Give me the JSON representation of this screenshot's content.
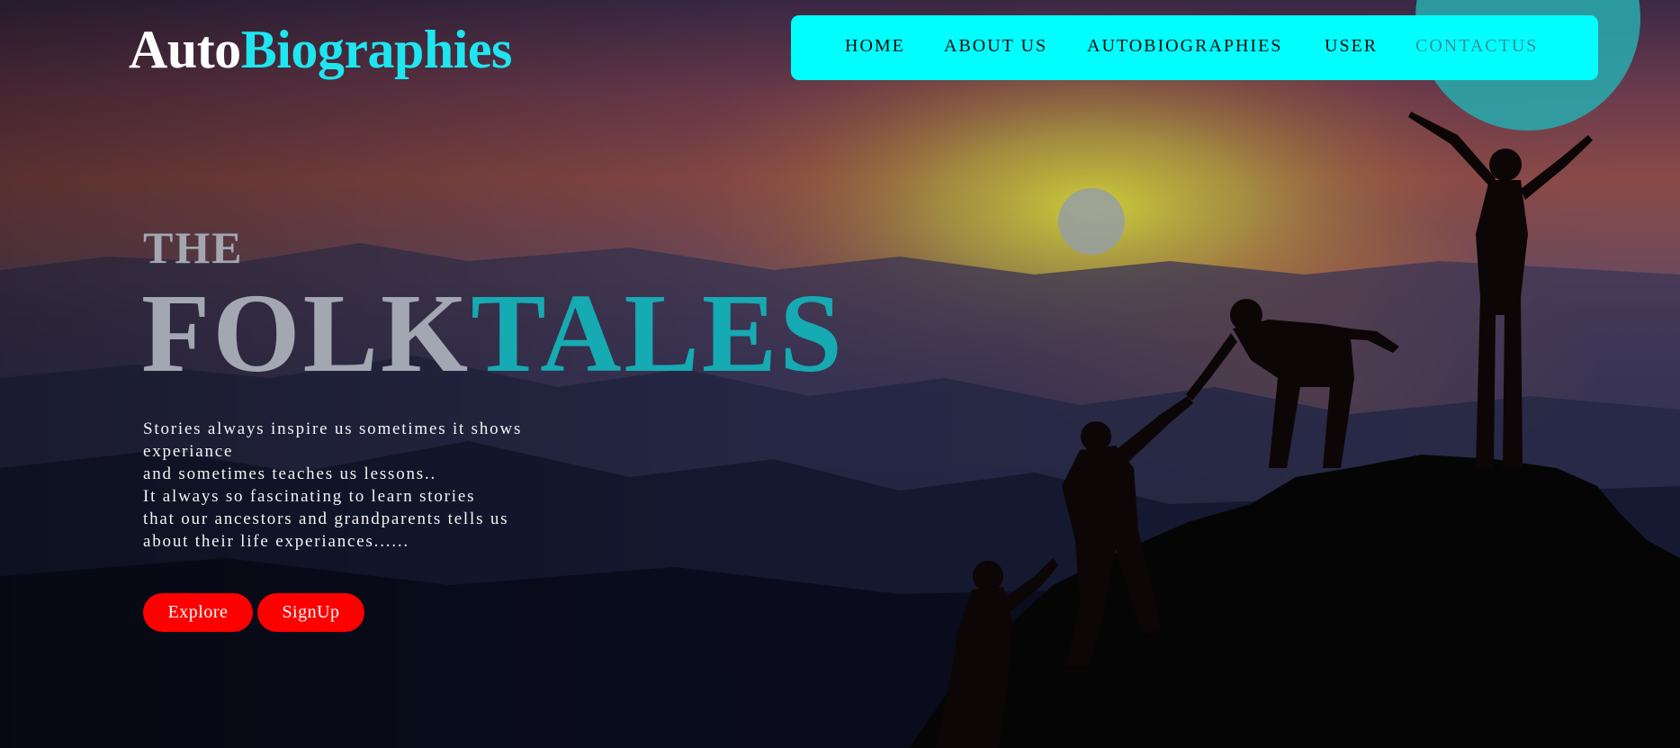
{
  "brand": {
    "part1": "Auto",
    "part2": "Biographies"
  },
  "nav": [
    {
      "label": "HOME"
    },
    {
      "label": "ABOUT US"
    },
    {
      "label": "AUTOBIOGRAPHIES"
    },
    {
      "label": "USER"
    },
    {
      "label": "CONTACTUS"
    }
  ],
  "hero": {
    "pre_title": "THE",
    "title_part1": "FOLK",
    "title_part2": "TALES",
    "description_lines": [
      "Stories always inspire us sometimes it shows",
      "experiance",
      "and sometimes teaches us lessons..",
      "It always so fascinating to learn stories",
      "that our ancestors and grandparents tells us",
      "about their life experiances......"
    ],
    "buttons": {
      "explore": "Explore",
      "signup": "SignUp"
    }
  },
  "colors": {
    "accent_cyan": "#00ffff",
    "brand_cyan": "#1ee6f0",
    "title_teal": "#16aab3",
    "button_red": "#ff0000",
    "title_gray": "#a3a7b2"
  },
  "icons": {
    "background": "mountain-climbers-sunset-image"
  }
}
